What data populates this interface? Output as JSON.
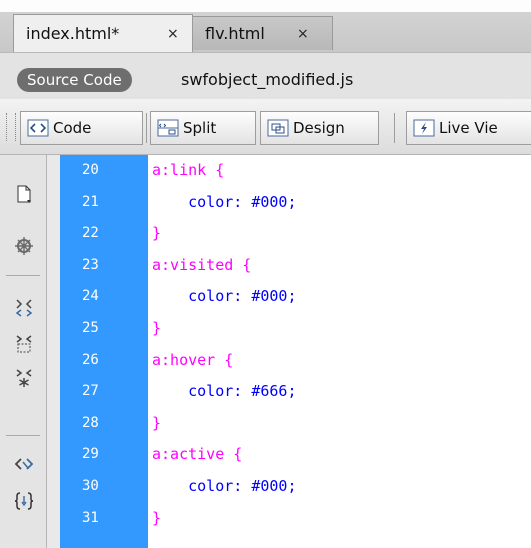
{
  "tabs": [
    {
      "label": "index.html*",
      "close": "×"
    },
    {
      "label": "flv.html",
      "close": "×"
    }
  ],
  "related_files": {
    "source_label": "Source Code",
    "file": "swfobject_modified.js"
  },
  "view_toolbar": {
    "code": "Code",
    "split": "Split",
    "design": "Design",
    "live": "Live Vie"
  },
  "coding_toolbar_icons": [
    "open-documents-icon",
    "show-code-navigator-icon",
    "collapse-full-tag-icon",
    "collapse-selection-icon",
    "expand-all-icon",
    "select-parent-tag-icon",
    "balance-braces-icon"
  ],
  "code_lines": [
    {
      "num": "20",
      "selector": "a:link {",
      "prop": "",
      "value": ""
    },
    {
      "num": "21",
      "selector": "",
      "prop": "color:",
      "value": "#000;"
    },
    {
      "num": "22",
      "selector": "}",
      "prop": "",
      "value": ""
    },
    {
      "num": "23",
      "selector": "a:visited {",
      "prop": "",
      "value": ""
    },
    {
      "num": "24",
      "selector": "",
      "prop": "color:",
      "value": "#000;"
    },
    {
      "num": "25",
      "selector": "}",
      "prop": "",
      "value": ""
    },
    {
      "num": "26",
      "selector": "a:hover {",
      "prop": "",
      "value": ""
    },
    {
      "num": "27",
      "selector": "",
      "prop": "color:",
      "value": "#666;"
    },
    {
      "num": "28",
      "selector": "}",
      "prop": "",
      "value": ""
    },
    {
      "num": "29",
      "selector": "a:active {",
      "prop": "",
      "value": ""
    },
    {
      "num": "30",
      "selector": "",
      "prop": "color:",
      "value": "#000;"
    },
    {
      "num": "31",
      "selector": "}",
      "prop": "",
      "value": ""
    }
  ],
  "colors": {
    "gutter": "#3399ff",
    "selector": "#ff00ff",
    "property": "#0000ff"
  }
}
